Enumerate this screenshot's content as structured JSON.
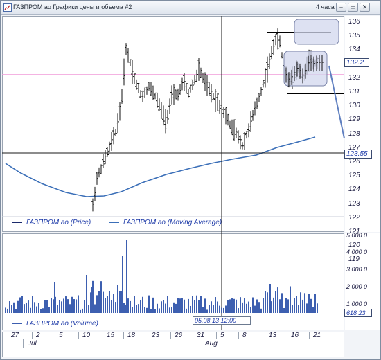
{
  "window": {
    "title": "ГАЗПРОМ ао Графики цены и объема #2",
    "period": "4 часа",
    "buttons": [
      "⎯",
      "▭",
      "✕"
    ]
  },
  "price_axis": {
    "ticks": [
      "136",
      "135",
      "134",
      "133",
      "132",
      "131",
      "130",
      "129",
      "128",
      "127",
      "126",
      "125",
      "124",
      "123",
      "122",
      "121",
      "120",
      "119"
    ],
    "last_price": "132.2",
    "cursor_price": "123.55"
  },
  "price_legend": {
    "price": "ГАЗПРОМ ао (Price)",
    "ma": "ГАЗПРОМ ао (Moving Average)"
  },
  "volume_axis": {
    "ticks": [
      "5 000 0",
      "4 000 0",
      "3 000 0",
      "2 000 0",
      "1 000 0"
    ],
    "last_volume": "618 23"
  },
  "volume_legend": {
    "volume": "ГАЗПРОМ ао (Volume)"
  },
  "cursor": {
    "datetime": "05.08.13 12:00"
  },
  "x_axis": {
    "days": [
      "27",
      "2",
      "5",
      "10",
      "15",
      "18",
      "23",
      "26",
      "31",
      "5",
      "8",
      "13",
      "16",
      "21"
    ],
    "months": [
      "Jul",
      "Aug"
    ]
  },
  "colors": {
    "price": "#111111",
    "ma": "#3b6fb8",
    "volume": "#3d5fb0",
    "pink_line": "#f19ad8",
    "highlight_fill": "#d2d7ee",
    "highlight_stroke": "#7a84a8"
  }
}
